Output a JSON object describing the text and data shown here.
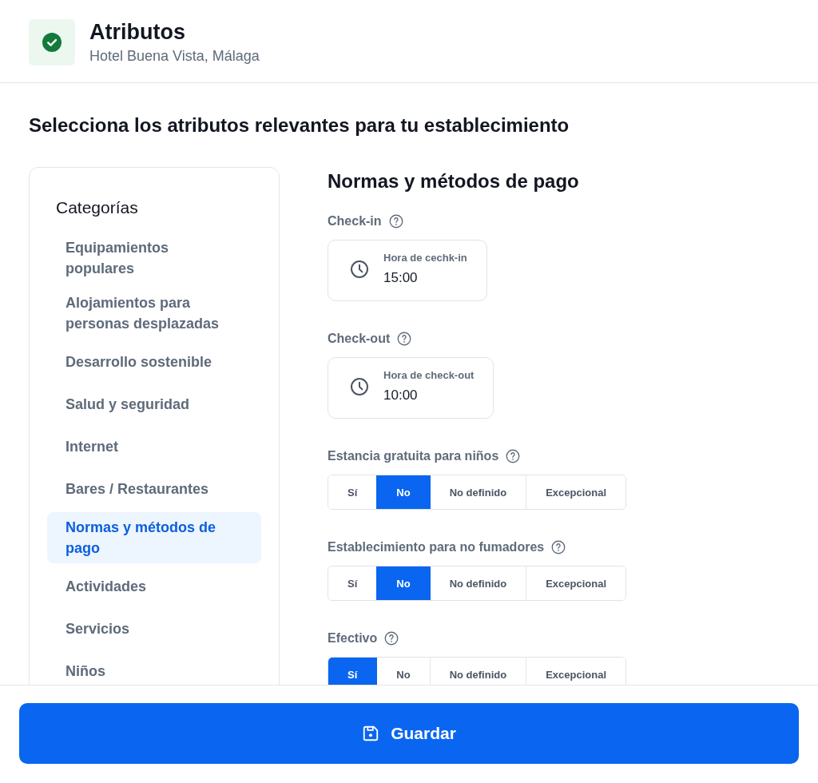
{
  "header": {
    "title": "Atributos",
    "subtitle": "Hotel Buena Vista, Málaga"
  },
  "prompt": "Selecciona los atributos relevantes para tu establecimiento",
  "sidebar": {
    "title": "Categorías",
    "items": [
      {
        "label": "Equipamientos populares",
        "selected": false
      },
      {
        "label": "Alojamientos para personas desplazadas",
        "selected": false
      },
      {
        "label": "Desarrollo sostenible",
        "selected": false
      },
      {
        "label": "Salud y seguridad",
        "selected": false
      },
      {
        "label": "Internet",
        "selected": false
      },
      {
        "label": "Bares / Restaurantes",
        "selected": false
      },
      {
        "label": "Normas y métodos de pago",
        "selected": true
      },
      {
        "label": "Actividades",
        "selected": false
      },
      {
        "label": "Servicios",
        "selected": false
      },
      {
        "label": "Niños",
        "selected": false
      }
    ]
  },
  "section": {
    "title": "Normas y métodos de pago",
    "fields": [
      {
        "kind": "time",
        "label": "Check-in",
        "input_label": "Hora de cechk-in",
        "value": "15:00"
      },
      {
        "kind": "time",
        "label": "Check-out",
        "input_label": "Hora de check-out",
        "value": "10:00"
      },
      {
        "kind": "choice",
        "label": "Estancia gratuita para niños",
        "options": [
          {
            "label": "Sí",
            "selected": false
          },
          {
            "label": "No",
            "selected": true
          },
          {
            "label": "No definido",
            "selected": false
          },
          {
            "label": "Excepcional",
            "selected": false
          }
        ]
      },
      {
        "kind": "choice",
        "label": "Establecimiento para no fumadores",
        "options": [
          {
            "label": "Sí",
            "selected": false
          },
          {
            "label": "No",
            "selected": true
          },
          {
            "label": "No definido",
            "selected": false
          },
          {
            "label": "Excepcional",
            "selected": false
          }
        ]
      },
      {
        "kind": "choice",
        "label": "Efectivo",
        "options": [
          {
            "label": "Sí",
            "selected": true
          },
          {
            "label": "No",
            "selected": false
          },
          {
            "label": "No definido",
            "selected": false
          },
          {
            "label": "Excepcional",
            "selected": false
          }
        ]
      }
    ]
  },
  "save_button": {
    "label": "Guardar"
  }
}
